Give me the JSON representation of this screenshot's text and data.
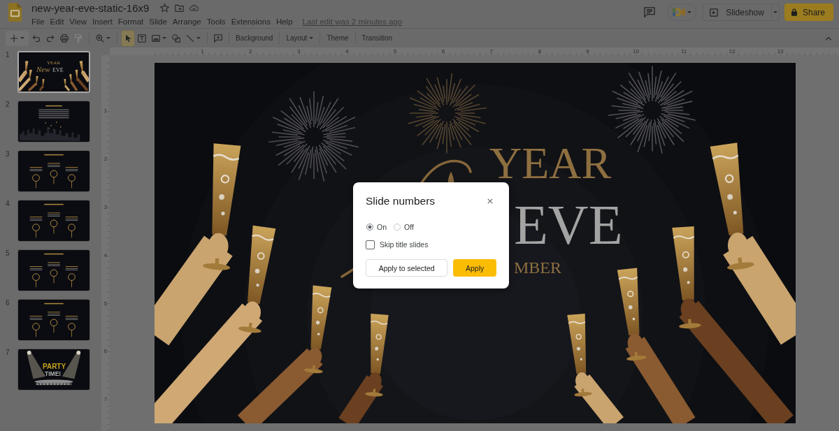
{
  "header": {
    "document_title": "new-year-eve-static-16x9",
    "menu": [
      "File",
      "Edit",
      "View",
      "Insert",
      "Format",
      "Slide",
      "Arrange",
      "Tools",
      "Extensions",
      "Help"
    ],
    "last_edit": "Last edit was 2 minutes ago",
    "slideshow_button": "Slideshow",
    "share_button": "Share"
  },
  "toolbar": {
    "actions": [
      {
        "kind": "new-slide",
        "dropdown": true,
        "disabled": false
      },
      {
        "kind": "undo",
        "dropdown": false,
        "disabled": false
      },
      {
        "kind": "redo",
        "dropdown": false,
        "disabled": false
      },
      {
        "kind": "print",
        "dropdown": false,
        "disabled": false
      },
      {
        "kind": "paint-format",
        "dropdown": false,
        "disabled": true
      },
      {
        "kind": "zoom",
        "dropdown": true,
        "disabled": false
      }
    ],
    "tools": [
      {
        "kind": "select",
        "dropdown": false,
        "selected": true
      },
      {
        "kind": "text-box",
        "dropdown": false,
        "selected": false
      },
      {
        "kind": "image",
        "dropdown": true,
        "selected": false
      },
      {
        "kind": "shape",
        "dropdown": false,
        "selected": false
      },
      {
        "kind": "line",
        "dropdown": true,
        "selected": false
      }
    ],
    "buttons": [
      {
        "label": "Background",
        "dropdown": false
      },
      {
        "label": "Layout",
        "dropdown": true
      },
      {
        "label": "Theme",
        "dropdown": false
      },
      {
        "label": "Transition",
        "dropdown": false
      }
    ]
  },
  "slides": [
    {
      "number": "1",
      "kind": "title",
      "selected": true,
      "texts": [
        "YEAR",
        "New",
        "EVE"
      ]
    },
    {
      "number": "2",
      "kind": "text",
      "selected": false
    },
    {
      "number": "3",
      "kind": "infographic",
      "selected": false
    },
    {
      "number": "4",
      "kind": "infographic",
      "selected": false
    },
    {
      "number": "5",
      "kind": "infographic",
      "selected": false
    },
    {
      "number": "6",
      "kind": "infographic",
      "selected": false
    },
    {
      "number": "7",
      "kind": "party",
      "selected": false,
      "texts": [
        "PARTY",
        "TIME!"
      ]
    }
  ],
  "rulers": {
    "horizontal": [
      "1",
      "2",
      "3",
      "4",
      "5",
      "6",
      "7",
      "8",
      "9",
      "10",
      "11",
      "12",
      "13"
    ],
    "vertical": [
      "1",
      "2",
      "3",
      "4",
      "5",
      "6",
      "7"
    ]
  },
  "slide": {
    "title_top": "YEAR",
    "title_bottom": "EVE",
    "subtitle": "MBER"
  },
  "dialog": {
    "title": "Slide numbers",
    "options": [
      {
        "label": "On",
        "selected": true
      },
      {
        "label": "Off",
        "selected": false
      }
    ],
    "skip_title_slides": {
      "label": "Skip title slides",
      "checked": false
    },
    "buttons": [
      {
        "label": "Apply to selected",
        "kind": "secondary"
      },
      {
        "label": "Apply",
        "kind": "primary"
      }
    ]
  }
}
